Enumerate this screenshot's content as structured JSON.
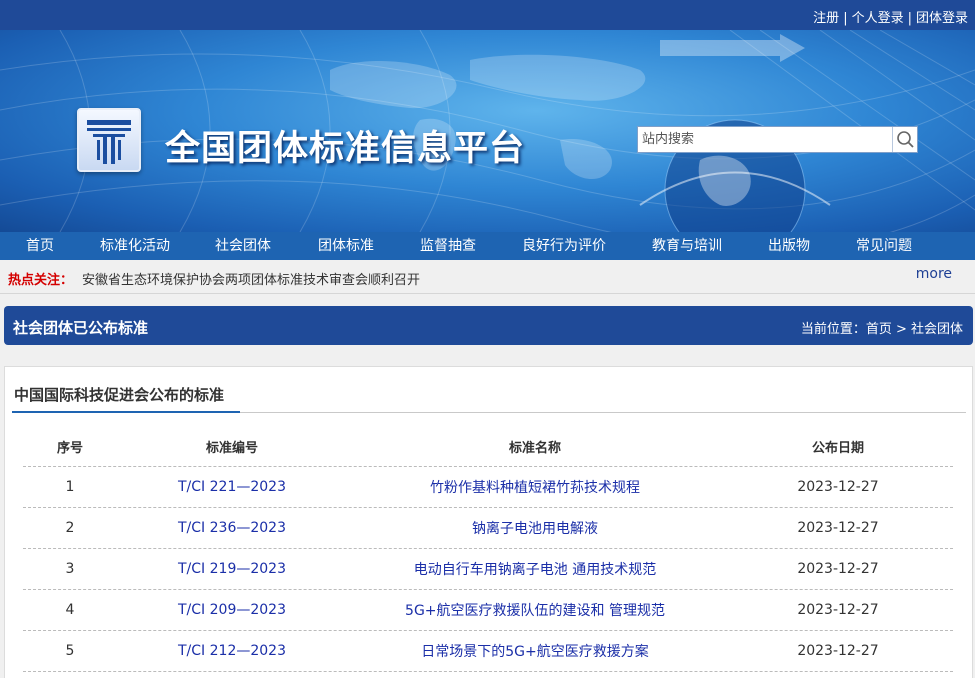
{
  "header": {
    "links": [
      "注册",
      "个人登录",
      "团体登录"
    ],
    "separator": "|",
    "site_title": "全国团体标准信息平台",
    "search_placeholder": "站内搜索"
  },
  "nav": [
    "首页",
    "标准化活动",
    "社会团体",
    "团体标准",
    "监督抽查",
    "良好行为评价",
    "教育与培训",
    "出版物",
    "常见问题"
  ],
  "hot": {
    "label": "热点关注：",
    "text": "安徽省生态环境保护协会两项团体标准技术审查会顺利召开",
    "more": "more"
  },
  "section": {
    "title": "社会团体已公布标准",
    "breadcrumb": "当前位置：首页 > 社会团体"
  },
  "panel": {
    "title": "中国国际科技促进会公布的标准",
    "headers": [
      "序号",
      "标准编号",
      "标准名称",
      "公布日期"
    ],
    "rows": [
      {
        "no": "1",
        "code": "T/CI 221—2023",
        "name": "竹粉作基料种植短裙竹荪技术规程",
        "date": "2023-12-27"
      },
      {
        "no": "2",
        "code": "T/CI 236—2023",
        "name": "钠离子电池用电解液",
        "date": "2023-12-27"
      },
      {
        "no": "3",
        "code": "T/CI 219—2023",
        "name": "电动自行车用钠离子电池 通用技术规范",
        "date": "2023-12-27"
      },
      {
        "no": "4",
        "code": "T/CI 209—2023",
        "name": "5G+航空医疗救援队伍的建设和 管理规范",
        "date": "2023-12-27"
      },
      {
        "no": "5",
        "code": "T/CI 212—2023",
        "name": "日常场景下的5G+航空医疗救援方案",
        "date": "2023-12-27"
      }
    ]
  },
  "colors": {
    "header_blue": "#1f4a98",
    "nav_blue": "#1e64b2",
    "hot_red": "#d40000",
    "link_blue": "#1b2fa8"
  }
}
